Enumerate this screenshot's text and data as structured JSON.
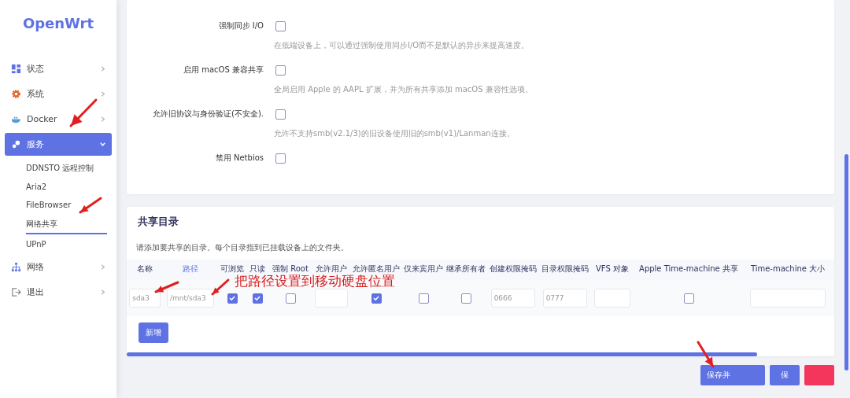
{
  "sidebar": {
    "logo": "OpenWrt",
    "items": [
      {
        "label": "状态",
        "selected": false,
        "expanded": false
      },
      {
        "label": "系统",
        "selected": false,
        "expanded": false
      },
      {
        "label": "Docker",
        "selected": false,
        "expanded": false
      },
      {
        "label": "服务",
        "selected": true,
        "expanded": true,
        "children": [
          {
            "label": "DDNSTO 远程控制",
            "selected": false
          },
          {
            "label": "Aria2",
            "selected": false
          },
          {
            "label": "FileBrowser",
            "selected": false
          },
          {
            "label": "网络共享",
            "selected": true
          },
          {
            "label": "UPnP",
            "selected": false
          }
        ]
      },
      {
        "label": "网络",
        "selected": false,
        "expanded": false
      },
      {
        "label": "退出",
        "selected": false,
        "expanded": false
      }
    ]
  },
  "options": [
    {
      "label": "强制同步 I/O",
      "checked": false,
      "description": "在低端设备上，可以通过强制使用同步I/O而不是默认的异步来提高速度。"
    },
    {
      "label": "启用 macOS 兼容共享",
      "checked": false,
      "description": "全局启用 Apple 的 AAPL 扩展，并为所有共享添加 macOS 兼容性选项。"
    },
    {
      "label": "允许旧协议与身份验证(不安全).",
      "checked": false,
      "description": "允许不支持smb(v2.1/3)的旧设备使用旧的smb(v1)/Lanman连接。"
    },
    {
      "label": "禁用 Netbios",
      "checked": false
    }
  ],
  "shares": {
    "title": "共享目录",
    "description": "请添加要共享的目录。每个目录指到已挂载设备上的文件夹。",
    "columns": [
      {
        "label": "名称",
        "kind": "plain"
      },
      {
        "label": "路径",
        "kind": "link"
      },
      {
        "label": "可浏览",
        "kind": "plain"
      },
      {
        "label": "只读",
        "kind": "plain"
      },
      {
        "label": "强制 Root",
        "kind": "plain"
      },
      {
        "label": "允许用户",
        "kind": "plain"
      },
      {
        "label": "允许匿名用户",
        "kind": "plain"
      },
      {
        "label": "仅来宾用户",
        "kind": "plain"
      },
      {
        "label": "继承所有者",
        "kind": "plain"
      },
      {
        "label": "创建权限掩码",
        "kind": "plain"
      },
      {
        "label": "目录权限掩码",
        "kind": "plain"
      },
      {
        "label": "VFS 对象",
        "kind": "plain"
      },
      {
        "label": "Apple Time-machine 共享",
        "kind": "plain"
      },
      {
        "label": "Time-machine 大小",
        "kind": "plain"
      }
    ],
    "rows": [
      {
        "cells": [
          {
            "kind": "text",
            "value": "sda3"
          },
          {
            "kind": "text",
            "value": "/mnt/sda3"
          },
          {
            "kind": "check",
            "checked": true
          },
          {
            "kind": "check",
            "checked": true
          },
          {
            "kind": "check",
            "checked": false
          },
          {
            "kind": "text"
          },
          {
            "kind": "check",
            "checked": true
          },
          {
            "kind": "check",
            "checked": false
          },
          {
            "kind": "check",
            "checked": false
          },
          {
            "kind": "text",
            "value": "0666"
          },
          {
            "kind": "text",
            "value": "0777"
          },
          {
            "kind": "text"
          },
          {
            "kind": "check",
            "checked": false
          },
          {
            "kind": "text"
          }
        ]
      }
    ],
    "add_button": "新增"
  },
  "buttons": [
    {
      "kind": "primary",
      "label": "保存并"
    },
    {
      "kind": "primary",
      "label": "保"
    },
    {
      "kind": "danger"
    }
  ],
  "annotation": "把路径设置到移动硬盘位置"
}
